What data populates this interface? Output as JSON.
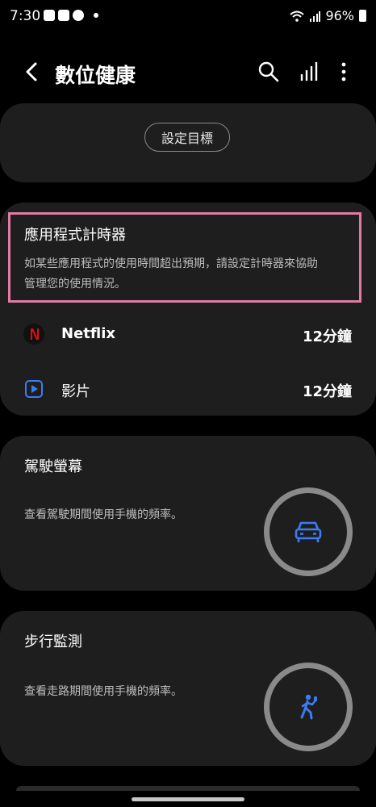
{
  "status_bar": {
    "time": "7:30",
    "battery": "96%"
  },
  "app_bar": {
    "title": "數位健康"
  },
  "goal": {
    "button_label": "設定目標"
  },
  "app_timers": {
    "title": "應用程式計時器",
    "description_line1": "如某些應用程式的使用時間超出預期，請設定計時器來協助",
    "description_line2": "管理您的使用情況。",
    "apps": [
      {
        "name": "Netflix",
        "time": "12分鐘",
        "icon": "netflix-icon"
      },
      {
        "name": "影片",
        "time": "12分鐘",
        "icon": "video-play-icon"
      }
    ]
  },
  "driving": {
    "title": "駕駛螢幕",
    "description": "查看駕駛期間使用手機的頻率。",
    "icon": "car-icon"
  },
  "walking": {
    "title": "步行監測",
    "description": "查看走路期間使用手機的頻率。",
    "icon": "walking-person-icon"
  },
  "colors": {
    "background": "#000000",
    "card": "#1e1e1e",
    "accent_blue": "#3b7cf4",
    "highlight_pink": "#e27ba3",
    "netflix_red": "#e50914"
  }
}
